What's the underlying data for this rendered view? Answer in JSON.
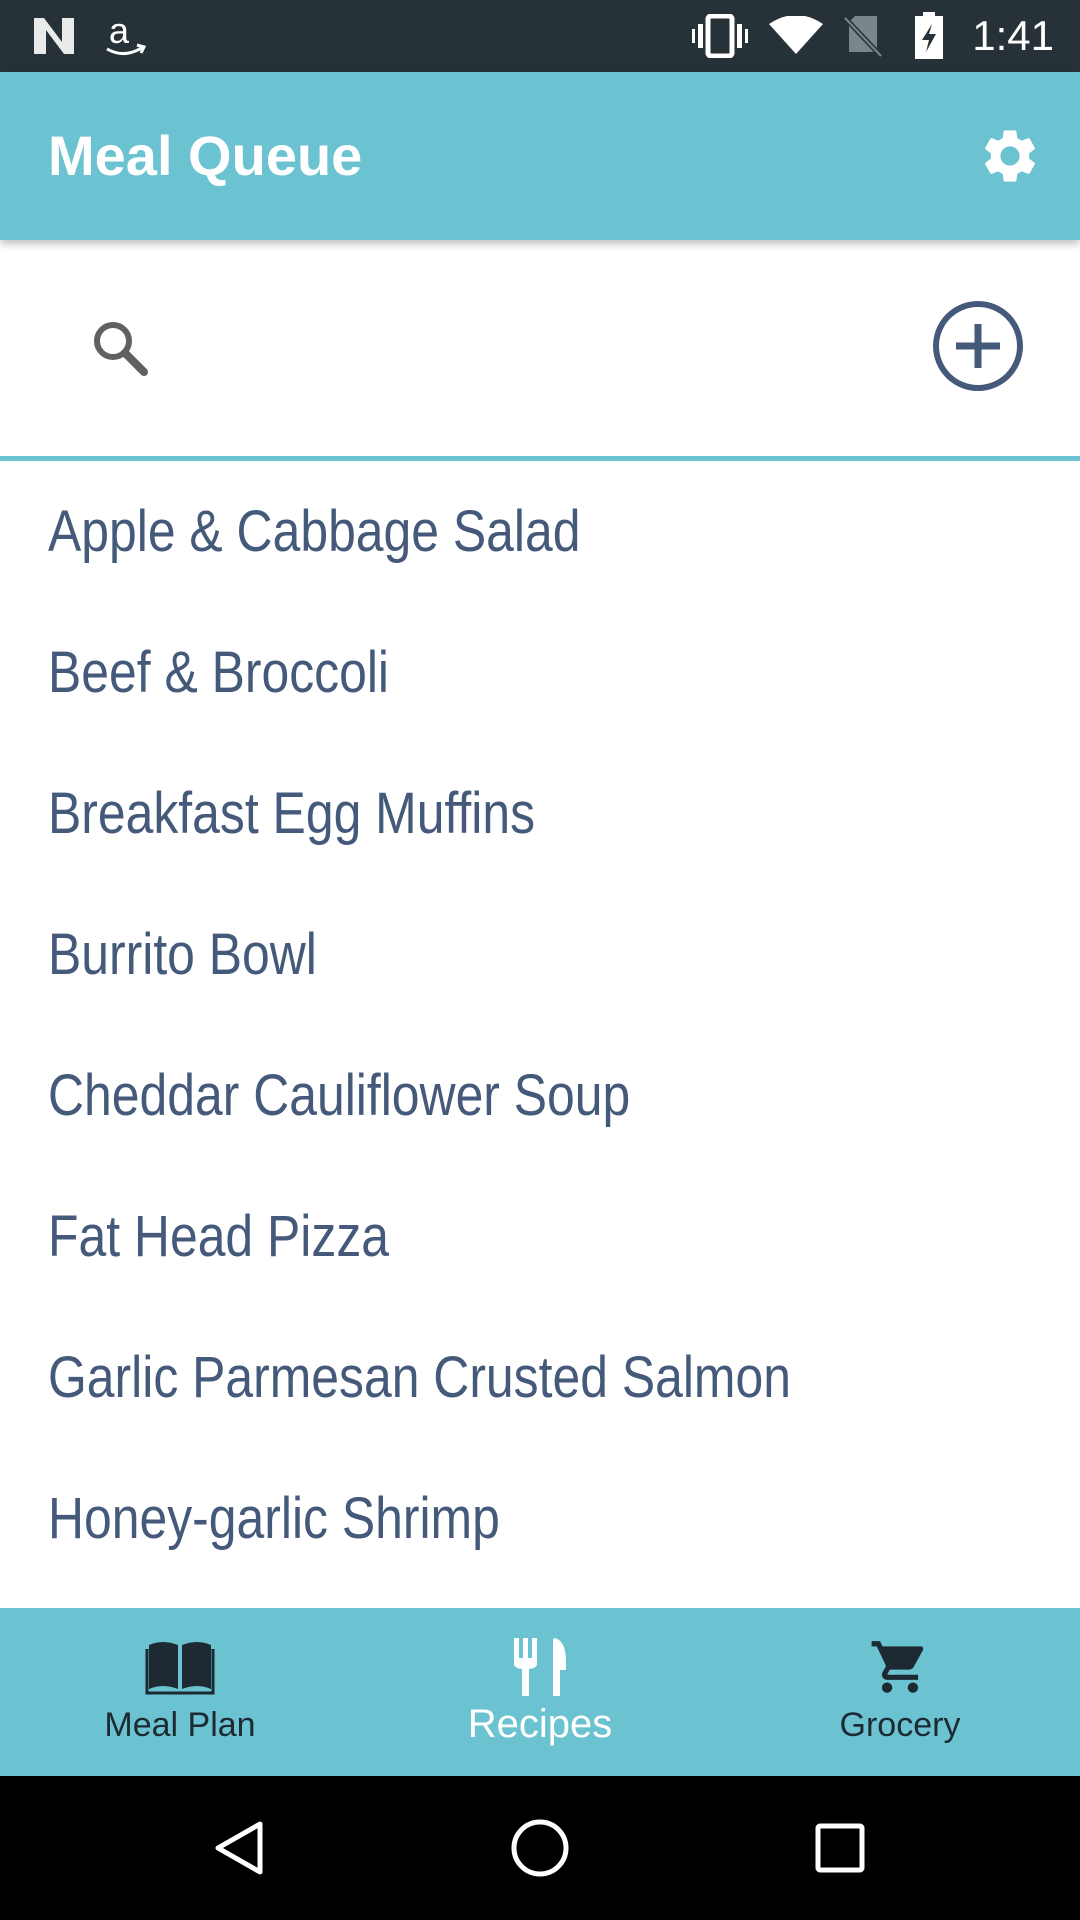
{
  "status_bar": {
    "time": "1:41",
    "icons": [
      "n-notification-icon",
      "amazon-icon",
      "vibrate-icon",
      "wifi-icon",
      "no-sim-icon",
      "battery-charging-icon"
    ]
  },
  "app_bar": {
    "title": "Meal Queue",
    "settings_icon": "gear-icon"
  },
  "search": {
    "value": "",
    "placeholder": "",
    "search_icon": "search-icon",
    "add_icon": "add-circle-icon"
  },
  "recipes": [
    "Apple & Cabbage Salad",
    "Beef & Broccoli",
    "Breakfast Egg Muffins",
    "Burrito Bowl",
    "Cheddar Cauliflower Soup",
    "Fat Head Pizza",
    "Garlic Parmesan Crusted Salmon",
    "Honey-garlic Shrimp"
  ],
  "bottom_nav": {
    "items": [
      {
        "label": "Meal Plan",
        "icon": "book-icon",
        "active": false
      },
      {
        "label": "Recipes",
        "icon": "fork-knife-icon",
        "active": true
      },
      {
        "label": "Grocery",
        "icon": "cart-icon",
        "active": false
      }
    ]
  },
  "colors": {
    "accent": "#6bc3d1",
    "status_bar": "#263238",
    "text": "#455a7a",
    "nav_text": "#1e2a33"
  }
}
